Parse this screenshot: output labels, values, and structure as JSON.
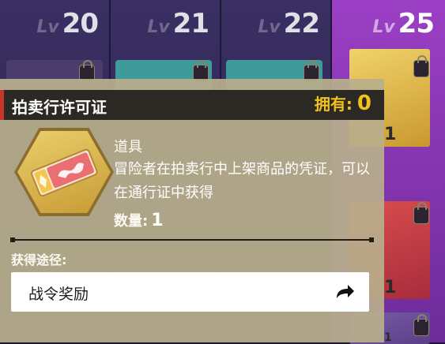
{
  "colors": {
    "accent_red": "#c8342c",
    "owned_yellow": "#f2c21b",
    "card_bg": "#b8ae8c",
    "header_bg": "#2c2824"
  },
  "tiers": [
    {
      "lv": "Lv",
      "level": "20"
    },
    {
      "lv": "Lv",
      "level": "21"
    },
    {
      "lv": "Lv",
      "level": "22"
    },
    {
      "lv": "Lv",
      "level": "25"
    }
  ],
  "reward_counts": [
    "1",
    "1",
    "1"
  ],
  "item": {
    "name": "拍卖行许可证",
    "owned_label": "拥有:",
    "owned_value": "0",
    "type": "道具",
    "description": "冒险者在拍卖行中上架商品的凭证，可以在通行证中获得",
    "quantity_label": "数量:",
    "quantity_value": "1",
    "icon": "auction-ticket-icon"
  },
  "obtain": {
    "label": "获得途径:",
    "sources": [
      {
        "label": "战令奖励",
        "icon": "go-arrow-icon"
      }
    ]
  }
}
